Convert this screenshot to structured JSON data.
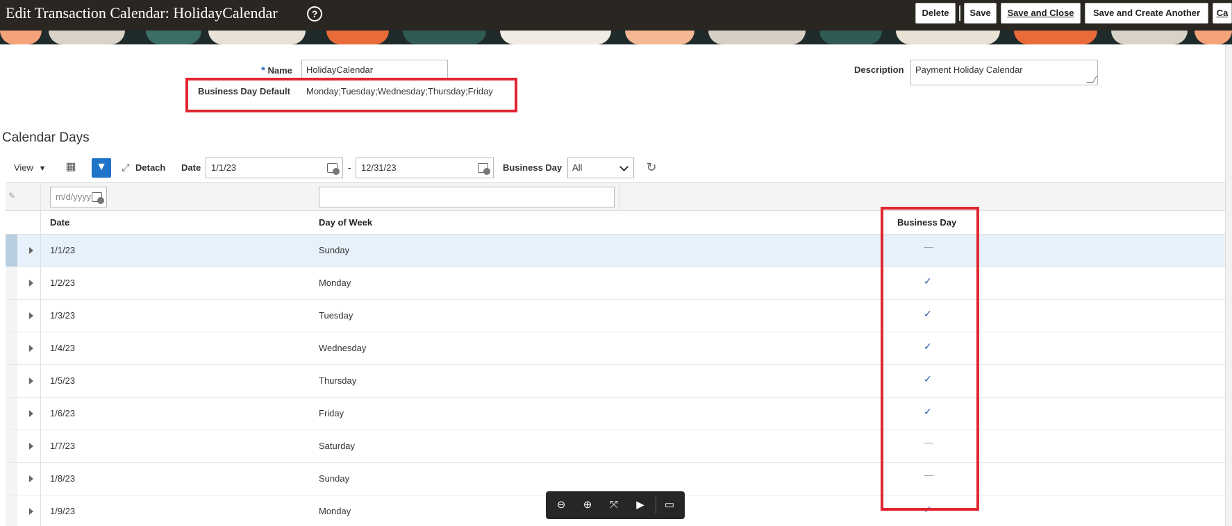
{
  "header": {
    "title": "Edit Transaction Calendar: HolidayCalendar",
    "help_icon": "question-circle-icon",
    "buttons": {
      "delete": "Delete",
      "save": "Save",
      "save_and_close": "Save and Close",
      "save_and_create_another": "Save and Create Another",
      "cancel_partial": "Ca"
    }
  },
  "form": {
    "name_label": "Name",
    "name_required_mark": "*",
    "name_value": "HolidayCalendar",
    "business_day_default_label": "Business Day Default",
    "business_day_default_value": "Monday;Tuesday;Wednesday;Thursday;Friday",
    "description_label": "Description",
    "description_value": "Payment Holiday Calendar"
  },
  "calendar_days": {
    "section_title": "Calendar Days",
    "toolbar": {
      "view_label": "View",
      "detach_label": "Detach",
      "date_label": "Date",
      "date_from": "1/1/23",
      "date_separator": "-",
      "date_to": "12/31/23",
      "business_day_label": "Business Day",
      "business_day_selected": "All"
    },
    "filter": {
      "date_placeholder": "m/d/yyyy",
      "day_of_week_value": ""
    },
    "columns": {
      "date": "Date",
      "day_of_week": "Day of Week",
      "business_day": "Business Day"
    },
    "rows": [
      {
        "date": "1/1/23",
        "day": "Sunday",
        "business_day": "—"
      },
      {
        "date": "1/2/23",
        "day": "Monday",
        "business_day": "✓"
      },
      {
        "date": "1/3/23",
        "day": "Tuesday",
        "business_day": "✓"
      },
      {
        "date": "1/4/23",
        "day": "Wednesday",
        "business_day": "✓"
      },
      {
        "date": "1/5/23",
        "day": "Thursday",
        "business_day": "✓"
      },
      {
        "date": "1/6/23",
        "day": "Friday",
        "business_day": "✓"
      },
      {
        "date": "1/7/23",
        "day": "Saturday",
        "business_day": "—"
      },
      {
        "date": "1/8/23",
        "day": "Sunday",
        "business_day": "—"
      },
      {
        "date": "1/9/23",
        "day": "Monday",
        "business_day": "✓"
      }
    ]
  },
  "colors": {
    "header_bg": "#2a2622",
    "highlight_red": "#e0262f",
    "selected_row": "#e6f1fb",
    "check_blue": "#2c5aa0"
  },
  "viewer_toolbar": {
    "icons": [
      "zoom-out-icon",
      "zoom-in-icon",
      "fit-screen-icon",
      "present-icon",
      "comment-icon"
    ]
  }
}
